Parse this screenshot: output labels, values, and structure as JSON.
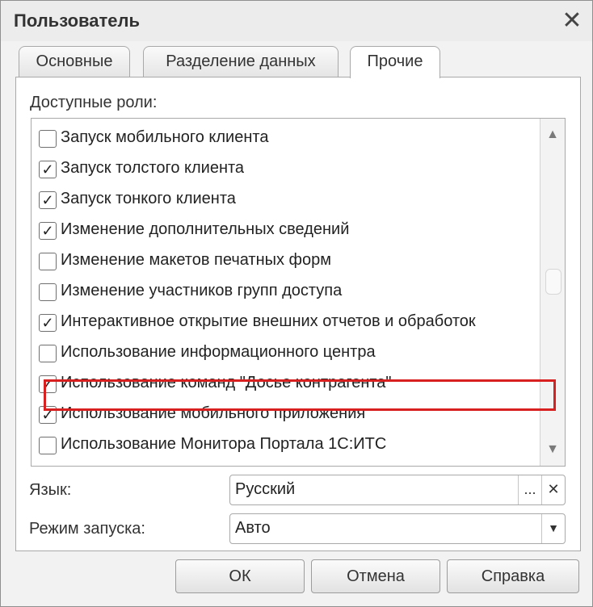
{
  "window": {
    "title": "Пользователь",
    "close_symbol": "✕"
  },
  "tabs": [
    {
      "label": "Основные",
      "active": false
    },
    {
      "label": "Разделение данных",
      "active": false
    },
    {
      "label": "Прочие",
      "active": true
    }
  ],
  "roles": {
    "label": "Доступные роли:",
    "items": [
      {
        "label": "Запуск мобильного клиента",
        "checked": false
      },
      {
        "label": "Запуск толстого клиента",
        "checked": true
      },
      {
        "label": "Запуск тонкого клиента",
        "checked": true
      },
      {
        "label": "Изменение дополнительных сведений",
        "checked": true
      },
      {
        "label": "Изменение макетов печатных форм",
        "checked": false
      },
      {
        "label": "Изменение участников групп доступа",
        "checked": false
      },
      {
        "label": "Интерактивное открытие внешних отчетов и обработок",
        "checked": true,
        "highlighted": true
      },
      {
        "label": "Использование информационного центра",
        "checked": false
      },
      {
        "label": "Использование команд \"Досье контрагента\"",
        "checked": true
      },
      {
        "label": "Использование мобильного приложения",
        "checked": true
      },
      {
        "label": "Использование Монитора Портала 1С:ИТС",
        "checked": false
      }
    ],
    "highlight_color": "#d82020"
  },
  "language": {
    "label": "Язык:",
    "value": "Русский",
    "select_symbol": "...",
    "clear_symbol": "✕"
  },
  "launch_mode": {
    "label": "Режим запуска:",
    "value": "Авто",
    "dropdown_symbol": "▼"
  },
  "buttons": {
    "ok": "ОК",
    "cancel": "Отмена",
    "help": "Справка"
  },
  "scrollbar": {
    "up_symbol": "▲",
    "down_symbol": "▼"
  },
  "checkmark": "✓"
}
